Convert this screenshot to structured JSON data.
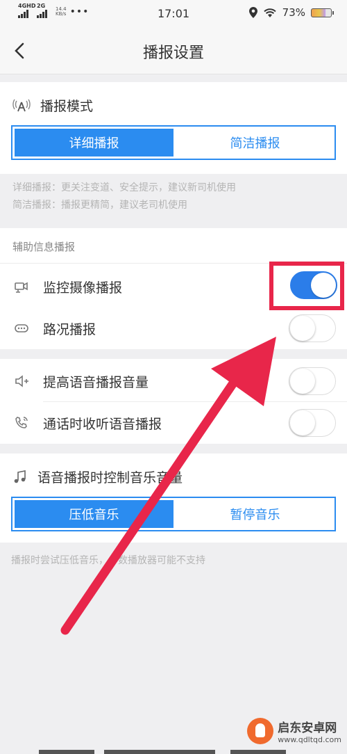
{
  "status_bar": {
    "network1": "4GHD",
    "network2": "2G",
    "speed_value": "14.4",
    "speed_unit": "KB/s",
    "more": "•••",
    "time": "17:01",
    "battery": "73%",
    "icons": [
      "location-icon",
      "wifi-icon",
      "battery-icon"
    ]
  },
  "nav": {
    "title": "播报设置",
    "back_icon": "chevron-left-icon"
  },
  "broadcast_mode": {
    "title": "播报模式",
    "icon": "broadcast-icon",
    "options": [
      "详细播报",
      "简洁播报"
    ],
    "selected": "详细播报",
    "notes": [
      "详细播报：更关注变道、安全提示，建议新司机使用",
      "简洁播报：播报更精简，建议老司机使用"
    ]
  },
  "aux": {
    "section_title": "辅助信息播报",
    "items": [
      {
        "label": "监控摄像播报",
        "icon": "camera-icon",
        "on": true
      },
      {
        "label": "路况播报",
        "icon": "traffic-icon",
        "on": false
      }
    ]
  },
  "voice": {
    "items": [
      {
        "label": "提高语音播报音量",
        "icon": "volume-up-icon",
        "on": false
      },
      {
        "label": "通话时收听语音播报",
        "icon": "phone-icon",
        "on": false
      }
    ]
  },
  "music": {
    "title": "语音播报时控制音乐音量",
    "icon": "music-icon",
    "options": [
      "压低音乐",
      "暂停音乐"
    ],
    "selected": "压低音乐",
    "note": "播报时尝试压低音乐，少数播放器可能不支持"
  },
  "watermark": {
    "name": "启东安卓网",
    "url": "www.qdltqd.com"
  },
  "colors": {
    "accent": "#2b8cf0",
    "toggle_on": "#2b7de9",
    "annotation": "#e8264a",
    "background": "#efeff1"
  }
}
